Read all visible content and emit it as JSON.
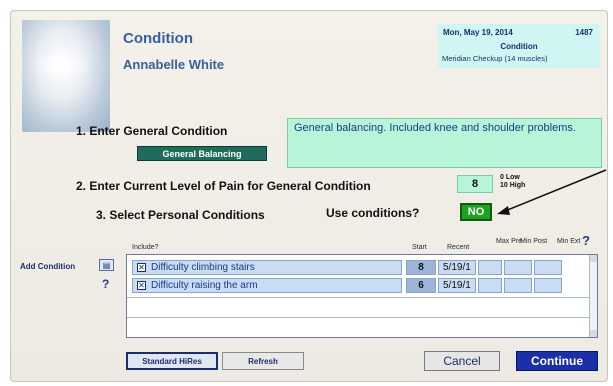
{
  "header": {
    "title": "Condition",
    "patient_name": "Annabelle White"
  },
  "info_box": {
    "date": "Mon, May 19, 2014",
    "record_id": "1487",
    "type": "Condition",
    "visit": "Meridian Checkup (14 muscles)"
  },
  "step1": {
    "label": "1. Enter General Condition",
    "button_label": "General Balancing",
    "condition_text": "General balancing. Included knee and shoulder problems."
  },
  "step2": {
    "label": "2. Enter Current Level of Pain for General Condition",
    "pain_value": "8",
    "hint_low": "0 Low",
    "hint_high": "10 High"
  },
  "step3": {
    "label": "3. Select Personal Conditions",
    "use_conditions_label": "Use conditions?",
    "use_conditions_value": "NO"
  },
  "conditions": {
    "add_label": "Add Condition",
    "add_icon": "add-row-icon",
    "help_glyph": "?",
    "columns": {
      "include": "Include?",
      "start": "Start",
      "recent": "Recent",
      "max_pre": "Max Pre",
      "min_post": "Min Post",
      "min_ext": "Min Ext"
    },
    "rows": [
      {
        "checked": true,
        "description": "Difficulty climbing stairs",
        "start": "8",
        "recent": "5/19/1"
      },
      {
        "checked": true,
        "description": "Difficulty raising the arm",
        "start": "6",
        "recent": "5/19/1"
      }
    ]
  },
  "footer": {
    "standard_hilites": "Standard HiRes",
    "refresh": "Refresh",
    "cancel": "Cancel",
    "continue": "Continue"
  },
  "colors": {
    "title_blue": "#38609c",
    "accent_green": "#b8f5d8",
    "no_button_green": "#20a020",
    "continue_blue": "#1a2fa8"
  }
}
